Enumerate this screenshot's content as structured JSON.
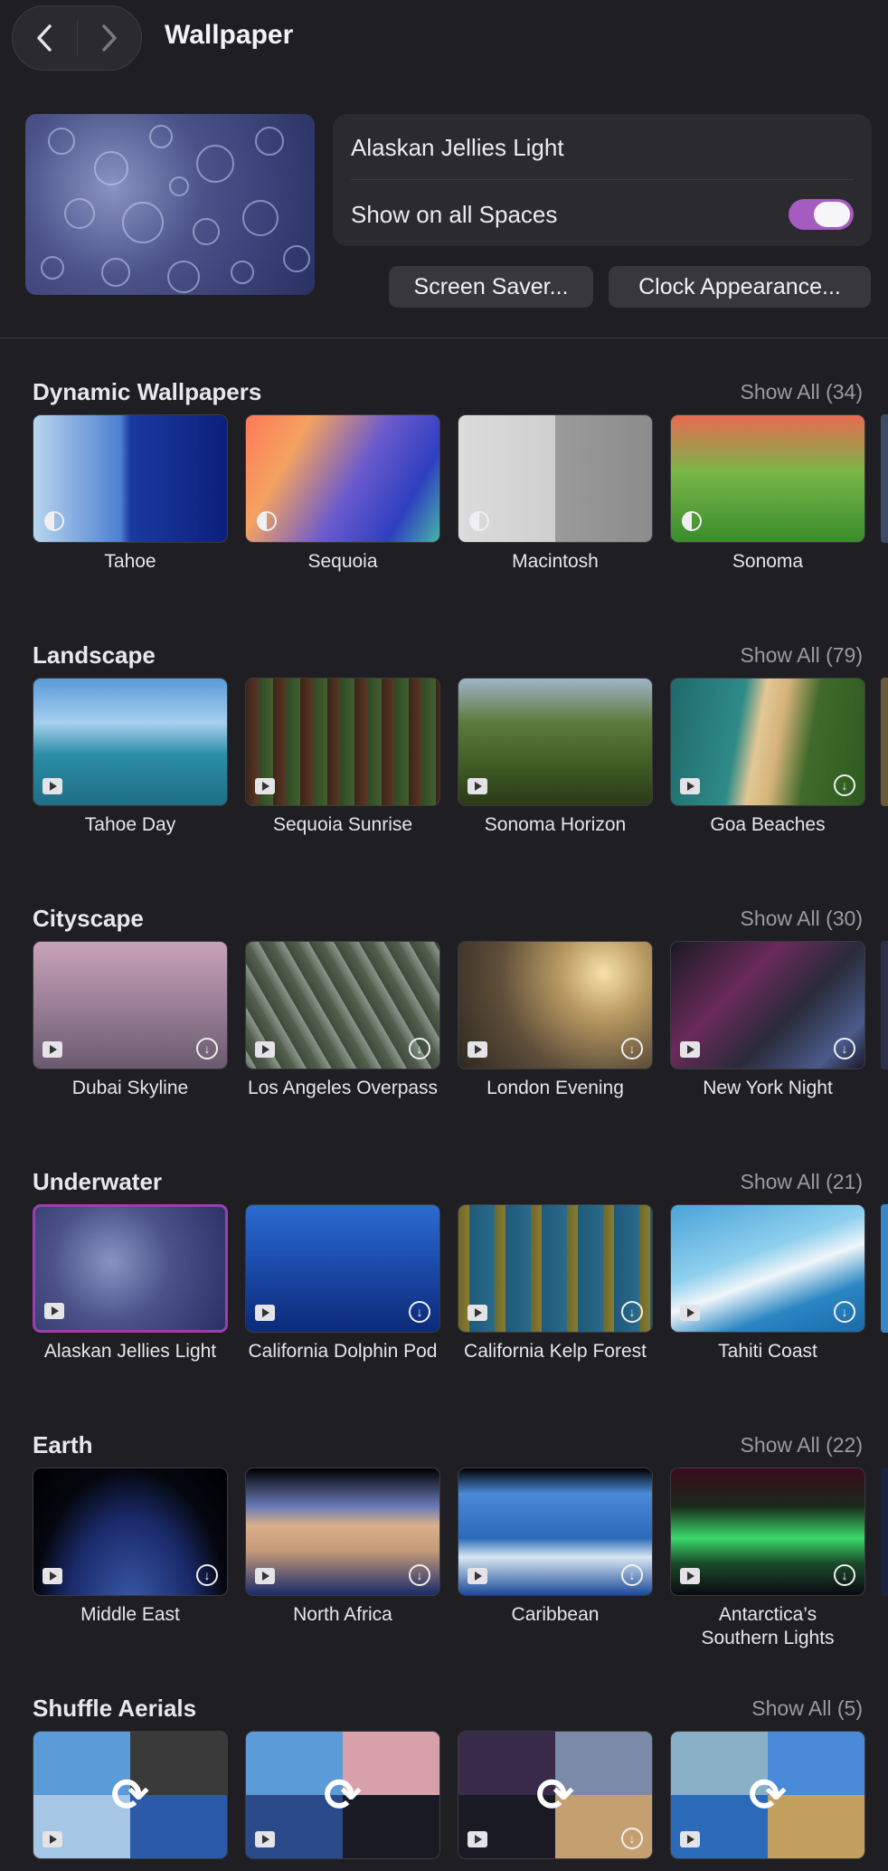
{
  "window": {
    "title": "Wallpaper"
  },
  "current": {
    "name": "Alaskan Jellies Light",
    "show_all_spaces_label": "Show on all Spaces",
    "show_all_spaces_on": true
  },
  "buttons": {
    "screen_saver": "Screen Saver...",
    "clock_appearance": "Clock Appearance..."
  },
  "sections": [
    {
      "title": "Dynamic Wallpapers",
      "show_all": "Show All (34)",
      "items": [
        {
          "label": "Tahoe"
        },
        {
          "label": "Sequoia"
        },
        {
          "label": "Macintosh"
        },
        {
          "label": "Sonoma"
        }
      ]
    },
    {
      "title": "Landscape",
      "show_all": "Show All (79)",
      "items": [
        {
          "label": "Tahoe Day"
        },
        {
          "label": "Sequoia Sunrise"
        },
        {
          "label": "Sonoma Horizon"
        },
        {
          "label": "Goa Beaches"
        }
      ]
    },
    {
      "title": "Cityscape",
      "show_all": "Show All (30)",
      "items": [
        {
          "label": "Dubai Skyline"
        },
        {
          "label": "Los Angeles Overpass"
        },
        {
          "label": "London Evening"
        },
        {
          "label": "New York Night"
        }
      ]
    },
    {
      "title": "Underwater",
      "show_all": "Show All (21)",
      "items": [
        {
          "label": "Alaskan Jellies Light"
        },
        {
          "label": "California Dolphin Pod"
        },
        {
          "label": "California Kelp Forest"
        },
        {
          "label": "Tahiti Coast"
        }
      ]
    },
    {
      "title": "Earth",
      "show_all": "Show All (22)",
      "items": [
        {
          "label": "Middle East"
        },
        {
          "label": "North Africa"
        },
        {
          "label": "Caribbean"
        },
        {
          "label": "Antarctica’s Southern Lights"
        }
      ]
    },
    {
      "title": "Shuffle Aerials",
      "show_all": "Show All (5)",
      "items": [
        {
          "label": ""
        },
        {
          "label": ""
        },
        {
          "label": ""
        },
        {
          "label": ""
        }
      ]
    }
  ],
  "colors": {
    "accent": "#a55bbf",
    "selected_border": "#9b3fb0",
    "background": "#1f1f23"
  }
}
